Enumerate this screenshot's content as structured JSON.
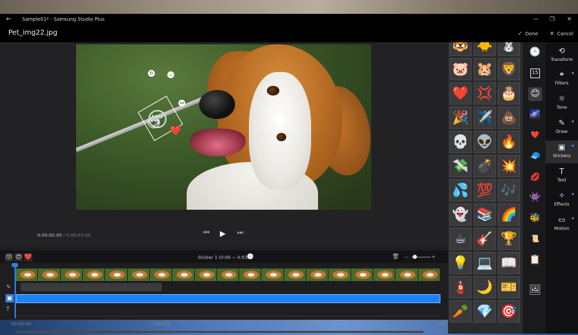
{
  "window": {
    "title": "Sample01* - Samsung Studio Plus",
    "back_glyph": "←",
    "min_glyph": "—",
    "max_glyph": "❐",
    "close_glyph": "✕"
  },
  "header": {
    "file_name": "Pet_img22.jpg",
    "done_label": "Done",
    "done_glyph": "✓",
    "cancel_label": "Cancel",
    "cancel_glyph": "✕"
  },
  "canvas_stickers": {
    "main": "😚",
    "second": "😍",
    "third": "❤️",
    "rotate_glyph": "↻",
    "close_glyph": "—",
    "scale_glyph": "↔"
  },
  "playback": {
    "current_time": "0:00:00.00",
    "separator": "/",
    "total_time": "0:00:03.00",
    "prev_glyph": "⏮",
    "play_glyph": "▶",
    "next_glyph": "⏭"
  },
  "timeline": {
    "mini_stickers": [
      "😚",
      "😍",
      "❤️"
    ],
    "clip_label": "Sticker 1 (0:00 ~ 0:03)",
    "clock_glyph": "🕒",
    "delete_glyph": "🗑",
    "zoom_min_glyph": "—",
    "zoom_max_glyph": "+",
    "side_icons": [
      "✎",
      "▣",
      "T"
    ],
    "ruler": [
      "00:00:00",
      "0:00:01",
      "0:00:02",
      "0:00"
    ]
  },
  "sticker_grid": [
    [
      "🐯",
      "🐥",
      "🐰"
    ],
    [
      "🐷",
      "🐹",
      "🦁"
    ],
    [
      "❤️",
      "💢",
      "🎂"
    ],
    [
      "🎉",
      "✈️",
      "💩"
    ],
    [
      "💀",
      "👽",
      "🔥"
    ],
    [
      "💸",
      "💣",
      "💥"
    ],
    [
      "💦",
      "💯",
      "🎶"
    ],
    [
      "👻",
      "📚",
      "🌈"
    ],
    [
      "☕",
      "🎸",
      "🏆"
    ],
    [
      "💡",
      "💻",
      "📖"
    ],
    [
      "🧯",
      "🌙",
      "🎫"
    ],
    [
      "🥕",
      "💎",
      "🎯"
    ]
  ],
  "categories": {
    "recent_glyph": "🕒",
    "calendar_number": "15",
    "items": [
      "😊",
      "🌌",
      "❤️",
      "🧢",
      "💋",
      "👾",
      "🐝",
      "📜",
      "📋"
    ],
    "add_glyph": "🖼"
  },
  "tools": [
    {
      "name": "transform",
      "label": "Transform",
      "glyph": "⟲"
    },
    {
      "name": "filters",
      "label": "Filters",
      "glyph": "⚭"
    },
    {
      "name": "tone",
      "label": "Tone",
      "glyph": "☼"
    },
    {
      "name": "draw",
      "label": "Draw",
      "glyph": "✎"
    },
    {
      "name": "stickers",
      "label": "Stickers",
      "glyph": "▣"
    },
    {
      "name": "text",
      "label": "Text",
      "glyph": "T"
    },
    {
      "name": "effects",
      "label": "Effects",
      "glyph": "✧"
    },
    {
      "name": "motion",
      "label": "Motion",
      "glyph": "▭"
    }
  ],
  "colors": {
    "accent": "#1b82f7",
    "background": "#1f1f21",
    "titlebar": "#000000"
  }
}
